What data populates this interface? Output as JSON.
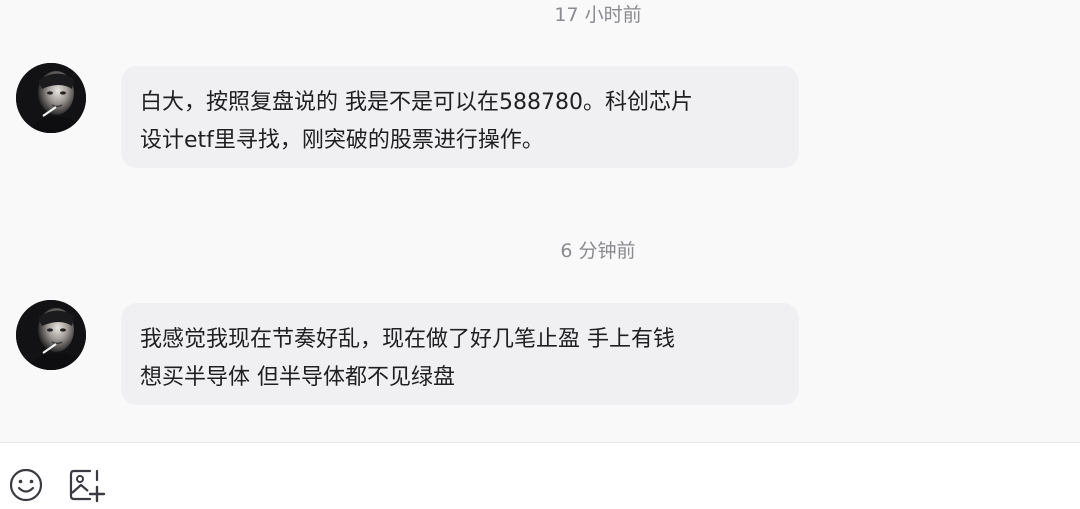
{
  "conversation": {
    "messages": [
      {
        "timestamp": "17 小时前",
        "sender_avatar": "avatar-icon",
        "lines": [
          "白大，按照复盘说的 我是不是可以在588780。科创芯片",
          "设计etf里寻找，刚突破的股票进行操作。"
        ]
      },
      {
        "timestamp": "6 分钟前",
        "sender_avatar": "avatar-icon",
        "lines": [
          "我感觉我现在节奏好乱，现在做了好几笔止盈 手上有钱",
          "想买半导体 但半导体都不见绿盘"
        ]
      }
    ]
  },
  "toolbar": {
    "buttons": [
      {
        "icon": "emoji-icon"
      },
      {
        "icon": "image-add-icon"
      }
    ]
  },
  "colors": {
    "chat_background": "#f9f9fa",
    "bubble_background": "#f0f0f3",
    "text": "#1f1f22",
    "timestamp_text": "#8a8a90"
  }
}
